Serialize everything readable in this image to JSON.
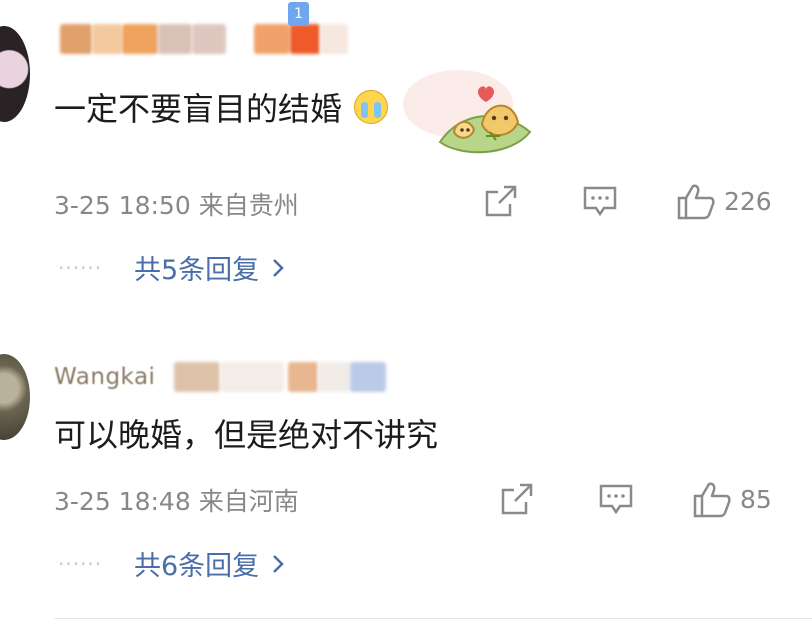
{
  "comments": [
    {
      "username_visible": "",
      "badge": "1",
      "text": "一定不要盲目的结婚",
      "timestamp": "3-25 18:50",
      "location": "来自贵州",
      "likes": "226",
      "replies_label": "共5条回复",
      "has_cry_emoji": true,
      "has_sticker": true
    },
    {
      "username_visible": "Wangkai",
      "text": "可以晚婚，但是绝对不讲究",
      "timestamp": "3-25 18:48",
      "location": "来自河南",
      "likes": "85",
      "replies_label": "共6条回复"
    }
  ],
  "colors": {
    "link": "#4a6ea8",
    "meta": "#888888",
    "badge": "#6fa6ef"
  },
  "icons": [
    "share-icon",
    "comment-icon",
    "like-icon",
    "chevron-right-icon"
  ]
}
